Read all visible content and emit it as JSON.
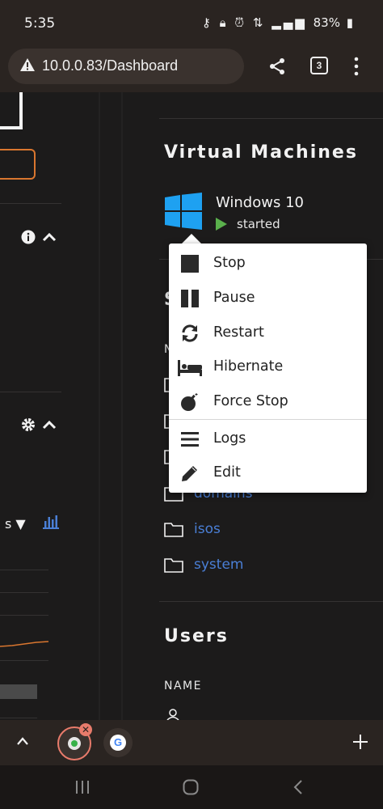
{
  "status_bar": {
    "time": "5:35",
    "battery": "83%",
    "icons": [
      "key-icon",
      "lock-icon",
      "alarm-icon",
      "data-icon",
      "signal-icon",
      "battery-icon"
    ]
  },
  "browser": {
    "url": "10.0.0.83/Dashboard",
    "tab_count": "3",
    "warning_icon": "warning-icon"
  },
  "left_panel": {
    "dropdown_text": "s ▼"
  },
  "vm_section": {
    "title": "Virtual Machines",
    "vm": {
      "name": "Windows 10",
      "status": "started",
      "status_color": "#5ab04c"
    }
  },
  "context_menu": {
    "items": [
      {
        "label": "Stop",
        "icon": "stop-icon"
      },
      {
        "label": "Pause",
        "icon": "pause-icon"
      },
      {
        "label": "Restart",
        "icon": "restart-icon"
      },
      {
        "label": "Hibernate",
        "icon": "bed-icon"
      },
      {
        "label": "Force Stop",
        "icon": "bomb-icon"
      },
      {
        "label": "Logs",
        "icon": "list-icon"
      },
      {
        "label": "Edit",
        "icon": "pencil-icon"
      }
    ]
  },
  "shares_section": {
    "title_partial": "S",
    "header_partial": "N",
    "folders": [
      "domains",
      "isos",
      "system"
    ]
  },
  "users_section": {
    "title": "Users",
    "name_header": "NAME"
  },
  "colors": {
    "accent_orange": "#d9762f",
    "link_blue": "#4a7fd6",
    "background": "#1c1b1b"
  }
}
